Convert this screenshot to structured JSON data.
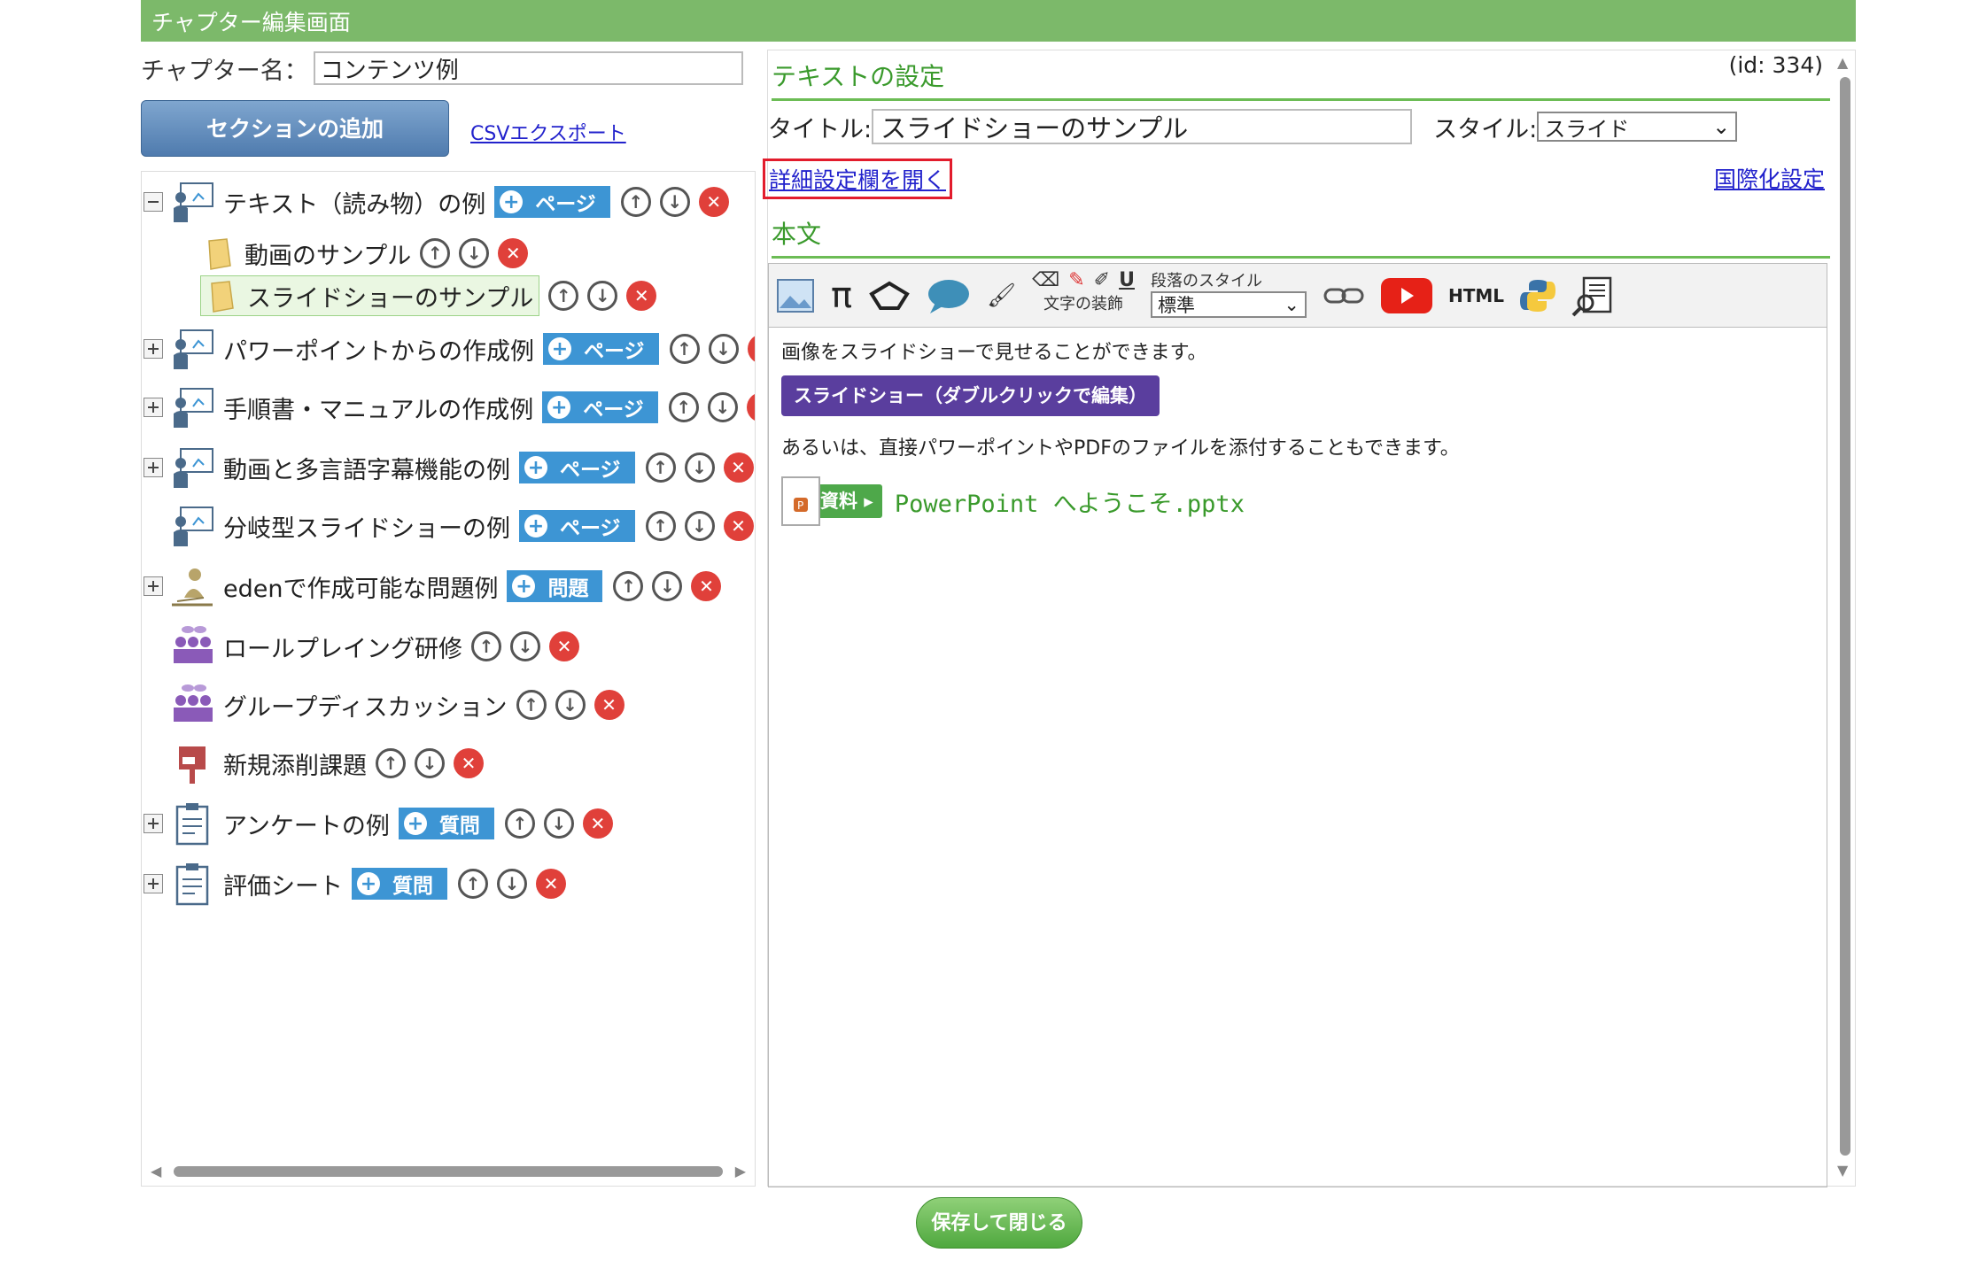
{
  "header": {
    "title": "チャプター編集画面"
  },
  "chapter": {
    "name_label": "チャプター名：",
    "name_value": "コンテンツ例"
  },
  "toolbar_left": {
    "add_section": "セクションの追加",
    "csv_export": "CSVエクスポート"
  },
  "tree": {
    "items": [
      {
        "label": "テキスト（読み物）の例",
        "badge": "ページ"
      },
      {
        "label": "動画のサンプル"
      },
      {
        "label": "スライドショーのサンプル"
      },
      {
        "label": "パワーポイントからの作成例",
        "badge": "ページ"
      },
      {
        "label": "手順書・マニュアルの作成例",
        "badge": "ページ"
      },
      {
        "label": "動画と多言語字幕機能の例",
        "badge": "ページ"
      },
      {
        "label": "分岐型スライドショーの例",
        "badge": "ページ"
      },
      {
        "label": "edenで作成可能な問題例",
        "badge": "問題"
      },
      {
        "label": "ロールプレイング研修"
      },
      {
        "label": "グループディスカッション"
      },
      {
        "label": "新規添削課題"
      },
      {
        "label": "アンケートの例",
        "badge": "質問"
      },
      {
        "label": "評価シート",
        "badge": "質問"
      }
    ]
  },
  "right": {
    "id_label": "(id: 334)",
    "text_settings": "テキストの設定",
    "title_label": "タイトル:",
    "title_value": "スライドショーのサンプル",
    "style_label": "スタイル:",
    "style_value": "スライド",
    "detail_link": "詳細設定欄を開く",
    "i18n_link": "国際化設定",
    "body_heading": "本文"
  },
  "editor": {
    "para_style_label": "段落のスタイル",
    "text_deco_label": "文字の装飾",
    "para_style_value": "標準",
    "html_label": "HTML",
    "line1": "画像をスライドショーで見せることができます。",
    "slideshow_button": "スライドショー（ダブルクリックで編集）",
    "line2": "あるいは、直接パワーポイントやPDFのファイルを添付することもできます。",
    "attach_tag": "資料",
    "attach_file": "PowerPoint へようこそ.pptx"
  },
  "footer": {
    "save_close": "保存して閉じる"
  },
  "colors": {
    "header": "#7cb96a",
    "accent_green": "#3a9a2c",
    "badge_blue": "#3d95d4",
    "slide_purple": "#5a3e9e",
    "delete_red": "#e0403a",
    "highlight_red": "#e21c2c"
  }
}
